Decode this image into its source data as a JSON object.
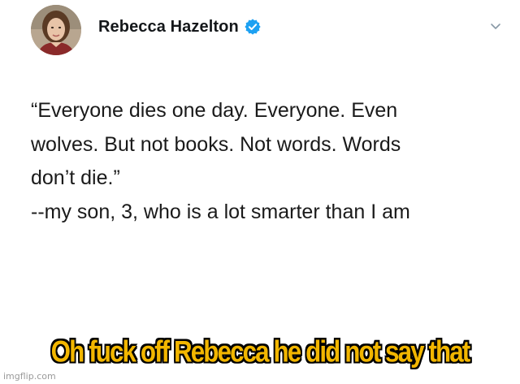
{
  "header": {
    "display_name": "Rebecca Hazelton",
    "verified_icon": "verified-badge-icon",
    "menu_icon": "chevron-down-icon"
  },
  "tweet": {
    "lines": [
      "“Everyone dies one day. Everyone. Even",
      "wolves. But not books. Not words. Words",
      "don’t die.”",
      "--my son, 3, who is a lot smarter than I am"
    ]
  },
  "meme": {
    "caption": "Oh fuck off Rebecca he did not say that",
    "watermark": "imgflip.com"
  },
  "colors": {
    "verified": "#1da1f2",
    "caption_fill": "#f2b600",
    "caption_outline": "#000000"
  }
}
